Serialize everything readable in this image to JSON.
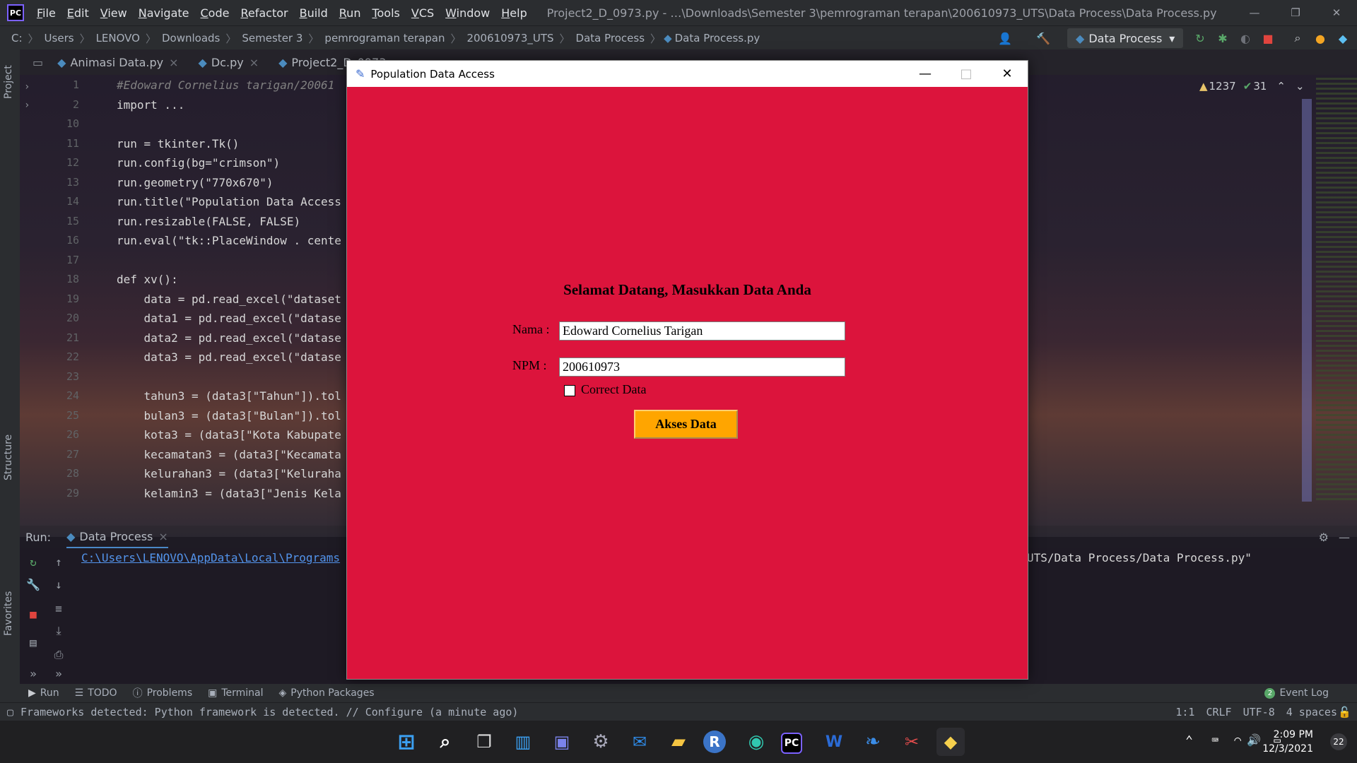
{
  "ide": {
    "menu": [
      "File",
      "Edit",
      "View",
      "Navigate",
      "Code",
      "Refactor",
      "Build",
      "Run",
      "Tools",
      "VCS",
      "Window",
      "Help"
    ],
    "window_title": "Project2_D_0973.py - …\\Downloads\\Semester 3\\pemrograman terapan\\200610973_UTS\\Data Process\\Data Process.py",
    "breadcrumb": [
      "C:",
      "Users",
      "LENOVO",
      "Downloads",
      "Semester 3",
      "pemrograman terapan",
      "200610973_UTS",
      "Data Process",
      "Data Process.py"
    ],
    "run_config": "Data Process",
    "tabs": [
      "Animasi Data.py",
      "Dc.py",
      "Project2_D_0973..."
    ],
    "warnings": "1237",
    "checks": "31",
    "left_labels": {
      "project": "Project",
      "structure": "Structure",
      "favorites": "Favorites"
    }
  },
  "code": {
    "lines": [
      {
        "n": "1",
        "text": "#Edoward Cornelius tarigan/20061"
      },
      {
        "n": "2",
        "text": "import ..."
      },
      {
        "n": "10",
        "text": ""
      },
      {
        "n": "11",
        "text": "run = tkinter.Tk()"
      },
      {
        "n": "12",
        "text": "run.config(bg=\"crimson\")"
      },
      {
        "n": "13",
        "text": "run.geometry(\"770x670\")"
      },
      {
        "n": "14",
        "text": "run.title(\"Population Data Access"
      },
      {
        "n": "15",
        "text": "run.resizable(FALSE, FALSE)"
      },
      {
        "n": "16",
        "text": "run.eval(\"tk::PlaceWindow . cente"
      },
      {
        "n": "17",
        "text": ""
      },
      {
        "n": "18",
        "text": "def xv():"
      },
      {
        "n": "19",
        "text": "    data = pd.read_excel(\"dataset"
      },
      {
        "n": "20",
        "text": "    data1 = pd.read_excel(\"datase"
      },
      {
        "n": "21",
        "text": "    data2 = pd.read_excel(\"datase"
      },
      {
        "n": "22",
        "text": "    data3 = pd.read_excel(\"datase"
      },
      {
        "n": "23",
        "text": ""
      },
      {
        "n": "24",
        "text": "    tahun3 = (data3[\"Tahun\"]).tol"
      },
      {
        "n": "25",
        "text": "    bulan3 = (data3[\"Bulan\"]).tol"
      },
      {
        "n": "26",
        "text": "    kota3 = (data3[\"Kota Kabupate"
      },
      {
        "n": "27",
        "text": "    kecamatan3 = (data3[\"Kecamata"
      },
      {
        "n": "28",
        "text": "    kelurahan3 = (data3[\"Keluraha"
      },
      {
        "n": "29",
        "text": "    kelamin3 = (data3[\"Jenis Kela"
      }
    ]
  },
  "run_panel": {
    "label": "Run:",
    "tab": "Data Process",
    "path_left": "C:\\Users\\LENOVO\\AppData\\Local\\Programs",
    "path_right": "UTS/Data Process/Data Process.py\""
  },
  "toolwindows": [
    "Run",
    "TODO",
    "Problems",
    "Terminal",
    "Python Packages"
  ],
  "event_log": {
    "count": "2",
    "label": "Event Log"
  },
  "status": {
    "message": "Frameworks detected: Python framework is detected. // Configure (a minute ago)",
    "position": "1:1",
    "line_sep": "CRLF",
    "encoding": "UTF-8",
    "indent": "4 spaces"
  },
  "taskbar": {
    "time": "2:09 PM",
    "date": "12/3/2021",
    "notifications": "22"
  },
  "tk": {
    "title": "Population Data Access",
    "heading": "Selamat Datang, Masukkan Data Anda",
    "nama_label": "Nama :",
    "nama_value": "Edoward Cornelius Tarigan",
    "npm_label": "NPM :",
    "npm_value": "200610973",
    "checkbox_label": "Correct Data",
    "button_label": "Akses Data",
    "bg_color": "#dc143c",
    "button_color": "#ffa500"
  }
}
